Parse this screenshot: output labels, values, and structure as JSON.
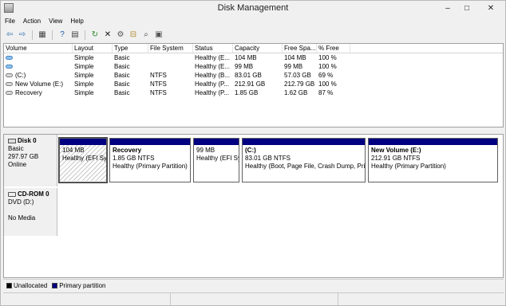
{
  "window": {
    "title": "Disk Management",
    "minimize": "–",
    "maximize": "□",
    "close": "✕"
  },
  "menu": [
    "File",
    "Action",
    "View",
    "Help"
  ],
  "toolbar": [
    {
      "icon": "back-arrow-icon",
      "glyph": "⇦"
    },
    {
      "icon": "forward-arrow-icon",
      "glyph": "⇨"
    },
    {
      "icon": "console-tree-icon",
      "glyph": "▦"
    },
    {
      "icon": "help-icon",
      "glyph": "?"
    },
    {
      "icon": "properties-icon",
      "glyph": "▤"
    },
    {
      "icon": "refresh-icon",
      "glyph": "↻"
    },
    {
      "icon": "delete-icon",
      "glyph": "✕"
    },
    {
      "icon": "settings-icon",
      "glyph": "⚙"
    },
    {
      "icon": "open-folder-icon",
      "glyph": "⊟"
    },
    {
      "icon": "search-icon",
      "glyph": "⌕"
    },
    {
      "icon": "rescan-disks-icon",
      "glyph": "▣"
    }
  ],
  "volume_table": {
    "columns": [
      "Volume",
      "Layout",
      "Type",
      "File System",
      "Status",
      "Capacity",
      "Free Spa...",
      "% Free"
    ],
    "rows": [
      {
        "volume": "",
        "icon": "blue",
        "layout": "Simple",
        "type": "Basic",
        "fs": "",
        "status": "Healthy (E...",
        "capacity": "104 MB",
        "free": "104 MB",
        "pct": "100 %"
      },
      {
        "volume": "",
        "icon": "blue",
        "layout": "Simple",
        "type": "Basic",
        "fs": "",
        "status": "Healthy (E...",
        "capacity": "99 MB",
        "free": "99 MB",
        "pct": "100 %"
      },
      {
        "volume": "(C:)",
        "icon": "gray",
        "layout": "Simple",
        "type": "Basic",
        "fs": "NTFS",
        "status": "Healthy (B...",
        "capacity": "83.01 GB",
        "free": "57.03 GB",
        "pct": "69 %"
      },
      {
        "volume": "New Volume (E:)",
        "icon": "gray",
        "layout": "Simple",
        "type": "Basic",
        "fs": "NTFS",
        "status": "Healthy (P...",
        "capacity": "212.91 GB",
        "free": "212.79 GB",
        "pct": "100 %"
      },
      {
        "volume": "Recovery",
        "icon": "gray",
        "layout": "Simple",
        "type": "Basic",
        "fs": "NTFS",
        "status": "Healthy (P...",
        "capacity": "1.85 GB",
        "free": "1.62 GB",
        "pct": "87 %"
      }
    ]
  },
  "disks": [
    {
      "name": "Disk 0",
      "lines": [
        "Basic",
        "297.97 GB",
        "Online"
      ],
      "partitions": [
        {
          "name": "",
          "size": "104 MB",
          "status": "Healthy (EFI Sys",
          "hatched": true
        },
        {
          "name": "Recovery",
          "size": "1.85 GB NTFS",
          "status": "Healthy (Primary Partition)",
          "hatched": false
        },
        {
          "name": "",
          "size": "99 MB",
          "status": "Healthy (EFI Sys",
          "hatched": false
        },
        {
          "name": "(C:)",
          "size": "83.01 GB NTFS",
          "status": "Healthy (Boot, Page File, Crash Dump, Prir",
          "hatched": false
        },
        {
          "name": "New Volume  (E:)",
          "size": "212.91 GB NTFS",
          "status": "Healthy (Primary Partition)",
          "hatched": false
        }
      ]
    },
    {
      "name": "CD-ROM 0",
      "lines": [
        "DVD (D:)",
        "",
        "No Media"
      ],
      "partitions": []
    }
  ],
  "legend": [
    {
      "label": "Unallocated",
      "color": "#000000"
    },
    {
      "label": "Primary partition",
      "color": "#000080"
    }
  ]
}
